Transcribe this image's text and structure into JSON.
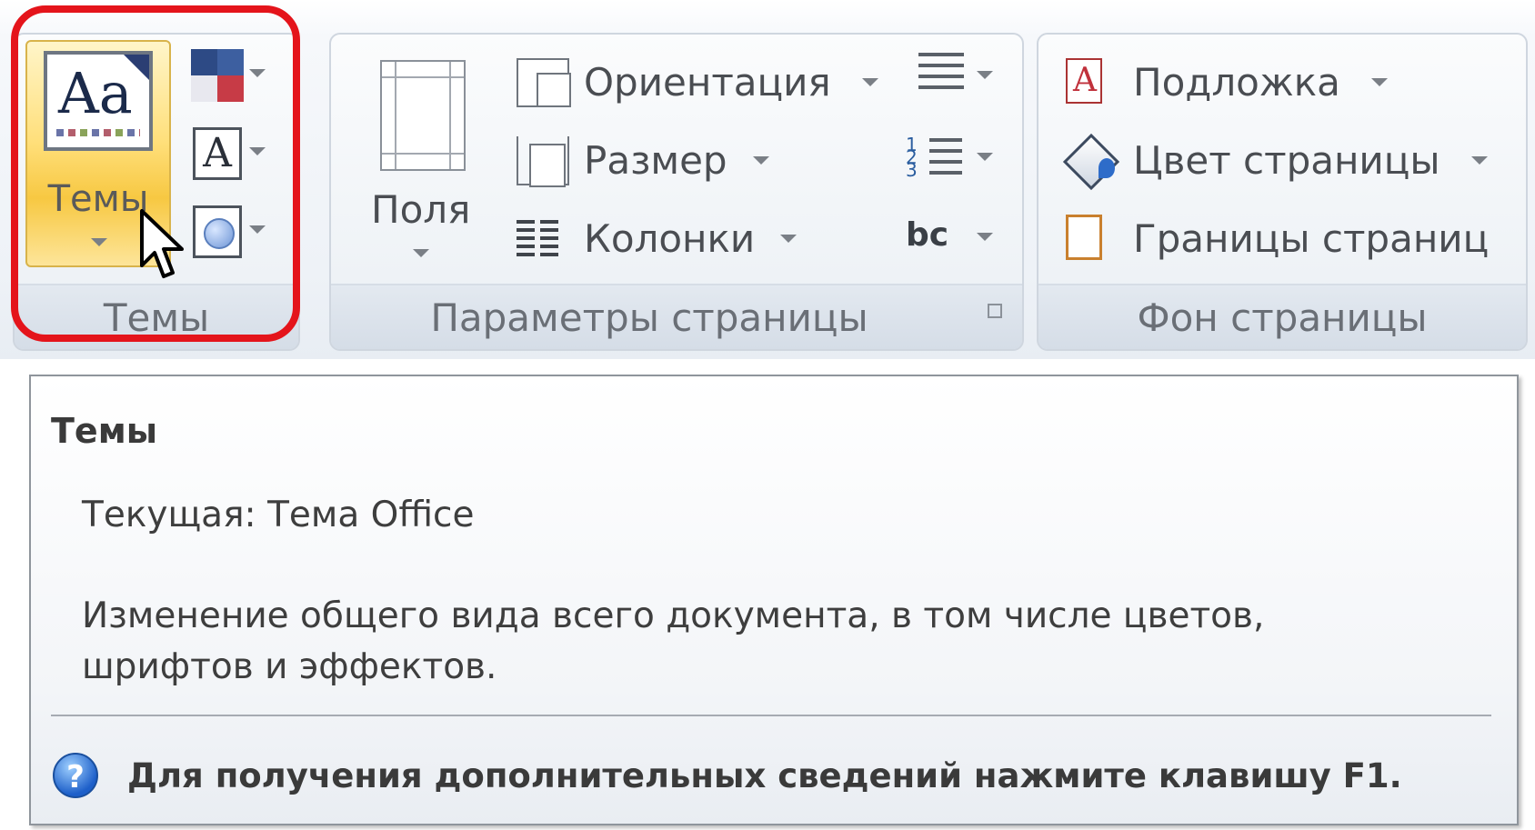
{
  "ribbon": {
    "themes_group": {
      "label": "Темы",
      "themes_button_label": "Темы",
      "themes_icon_text": "Aa",
      "fonts_icon_text": "A"
    },
    "page_setup_group": {
      "label": "Параметры страницы",
      "margins_label": "Поля",
      "orientation_label": "Ориентация",
      "size_label": "Размер",
      "columns_label": "Колонки",
      "line_numbers_icon_text": "1 2 3",
      "hyphenation_icon_text": "bc"
    },
    "page_background_group": {
      "label": "Фон страницы",
      "watermark_label": "Подложка",
      "page_color_label": "Цвет страницы",
      "page_borders_label": "Границы страниц"
    }
  },
  "tooltip": {
    "title": "Темы",
    "current": "Текущая: Тема Office",
    "description": "Изменение общего вида всего документа, в том числе цветов, шрифтов и эффектов.",
    "help_icon_text": "?",
    "help_text": "Для получения дополнительных сведений нажмите клавишу F1."
  },
  "colors": {
    "highlight_border": "#e4141b",
    "active_button": "#ffdf7a"
  }
}
